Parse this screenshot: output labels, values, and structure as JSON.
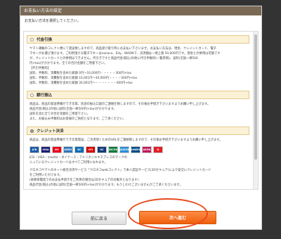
{
  "header": {
    "title": "お支払い方法の設定"
  },
  "instruction": "お支払い方法を選択してください。",
  "methods": [
    {
      "title": "代金引換",
      "lines": [
        "ヤマト運輸のコレクト便にて発送致しますので、商品受け取り時にお支払い下さいませ。お支払い方法は、現金、クレジットカード、電子",
        "マネーがお選び頂けます。ご利用頂ける電子マネーはnanaco、Edy、WAONで、決済額は一律上限 50,000円です。現金との併用は可能です",
        "が、クレジットカードとの併用はできません。代引きですと商品代金(税込)の他に代引手数料(一覧参照)、送料(全国一律500",
        "円+tax)がかかります。全ての合計金額をご用意下さい。",
        "【代引手数料】",
        "送料、手数料、消費税を含めた総額 0円〜10,000円・・・・・300円+tax",
        "送料、手数料、消費税を含めた総額 10,001円〜30,000円・・・・400円+tax",
        "送料、手数料、消費税を含めた総額 30,001円〜・・・・・・・600円+tax"
      ]
    },
    {
      "title": "銀行振込",
      "lines": [
        "商品は、商品の発送準備ができ次第、別途の振込口座のご連絡を致しますので、その後お手続き下さいますようお願い申し上げます。",
        "商品代金(税込)の他に送料(全国一律500円+tax)がかかります。",
        "送料を含む全ての合計金額をご用意下さい。",
        "また、お振込み手数料はお客様のご負担となります。ご了承ください。"
      ]
    },
    {
      "title": "クレジット決済",
      "lines": [
        "商品は、商品の発送準備ができ次第発送。ご決済頂くためのURLをご連絡致しますので、その後お手続き下さいますようお願い申し上げます。"
      ],
      "cards": [
        "JCB",
        "VISA",
        "MC",
        "AMEX",
        "DC",
        "UFJ",
        "UC",
        "NICOS",
        "SAISON",
        "DINERS",
        "AEON",
        "D"
      ],
      "lines2": [
        "JCB・VISA・master・ダイナース・アメリカンエキスプレスのマークの",
        "入っているクレジットカードはすべてご利用になれます。",
        "",
        "クロネコヤマトのネット総合決済サービス「クロネコwebコレクト」で本人認証サービス(3Dセキュア)により安全にクレジットカード",
        "をご利用いただけます。",
        "(本携帯電話でのお支払手続きをご利用の場合は3Dセキュアの対象外となります)",
        "商品代金(税込)の他に送料(全国一律500円+tax)がかかります。もうしわけございませんがご了承くださいませ。"
      ]
    }
  ],
  "selected_method": "クレジット決済",
  "buttons": {
    "back": "前に戻る",
    "next": "次へ進む"
  },
  "colors": {
    "accent": "#f0600c",
    "header_bg": "#7a6a55",
    "section_bg": "#fbf1d6"
  }
}
